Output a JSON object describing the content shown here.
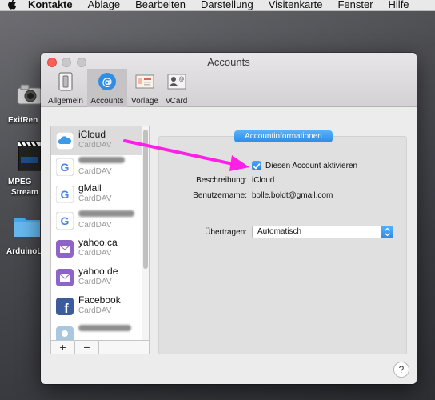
{
  "menubar": {
    "app": "Kontakte",
    "items": [
      "Ablage",
      "Bearbeiten",
      "Darstellung",
      "Visitenkarte",
      "Fenster",
      "Hilfe"
    ]
  },
  "desktop": {
    "icons": [
      {
        "label": "ExifRen"
      },
      {
        "label": "MPEG",
        "label2": "Stream"
      },
      {
        "label": "ArduinoL"
      }
    ]
  },
  "window": {
    "title": "Accounts",
    "toolbar": [
      {
        "label": "Allgemein",
        "selected": false
      },
      {
        "label": "Accounts",
        "selected": true
      },
      {
        "label": "Vorlage",
        "selected": false
      },
      {
        "label": "vCard",
        "selected": false
      }
    ],
    "accounts": [
      {
        "name": "iCloud",
        "type": "CardDAV",
        "icon": "icloud-icon",
        "selected": true
      },
      {
        "name": "",
        "type": "CardDAV",
        "icon": "google-icon",
        "redacted": true
      },
      {
        "name": "gMail",
        "type": "CardDAV",
        "icon": "google-icon"
      },
      {
        "name": "",
        "type": "CardDAV",
        "icon": "google-icon",
        "redacted": true
      },
      {
        "name": "yahoo.ca",
        "type": "CardDAV",
        "icon": "mail-icon"
      },
      {
        "name": "yahoo.de",
        "type": "CardDAV",
        "icon": "mail-icon"
      },
      {
        "name": "Facebook",
        "type": "CardDAV",
        "icon": "facebook-icon"
      },
      {
        "name": "",
        "type": "",
        "icon": "contacts-icon",
        "redacted": true
      }
    ],
    "list_footer": {
      "add": "+",
      "remove": "−"
    },
    "detail": {
      "tab": "Accountinformationen",
      "enable_label": "Diesen Account aktivieren",
      "enable_checked": true,
      "description_label": "Beschreibung:",
      "description_value": "iCloud",
      "username_label": "Benutzername:",
      "username_value": "bolle.boldt@gmail.com",
      "transfer_label": "Übertragen:",
      "transfer_value": "Automatisch"
    },
    "help": "?"
  },
  "colors": {
    "accent": "#2a8be7",
    "annotation_arrow": "#ff1fe6"
  }
}
